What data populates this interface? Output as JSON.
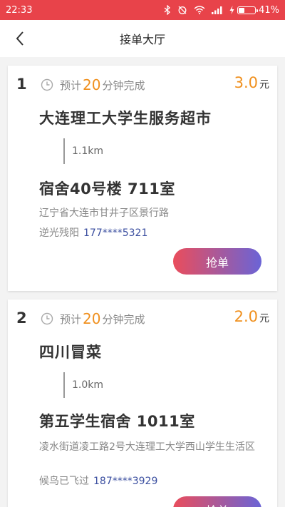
{
  "status_bar": {
    "time": "22:33",
    "battery_text": "41%",
    "battery_level": 0.41,
    "icons": [
      "bluetooth-icon",
      "alarm-off-icon",
      "wifi-icon",
      "signal-icon",
      "charging-icon",
      "battery-icon"
    ],
    "background": "#e8434a"
  },
  "header": {
    "title": "接单大厅",
    "back_icon": "chevron-left-icon"
  },
  "orders": [
    {
      "index": "1",
      "eta_prefix": "预计",
      "eta_minutes": "20",
      "eta_suffix": "分钟完成",
      "price": "3.0",
      "price_unit": "元",
      "shop": "大连理工大学生服务超市",
      "distance": "1.1km",
      "destination": "宿舍40号楼 711室",
      "address": "辽宁省大连市甘井子区景行路",
      "customer": "逆光残阳",
      "phone": "177****5321",
      "button": "抢单"
    },
    {
      "index": "2",
      "eta_prefix": "预计",
      "eta_minutes": "20",
      "eta_suffix": "分钟完成",
      "price": "2.0",
      "price_unit": "元",
      "shop": "四川冒菜",
      "distance": "1.0km",
      "destination": "第五学生宿舍 1011室",
      "address": "凌水街道凌工路2号大连理工大学西山学生生活区",
      "customer": "候鸟已飞过",
      "phone": "187****3929",
      "button": "抢单"
    }
  ],
  "colors": {
    "accent_orange": "#f0901e",
    "phone_blue": "#3b4fa0",
    "button_gradient_start": "#ea4d5c",
    "button_gradient_end": "#6a64d6"
  }
}
